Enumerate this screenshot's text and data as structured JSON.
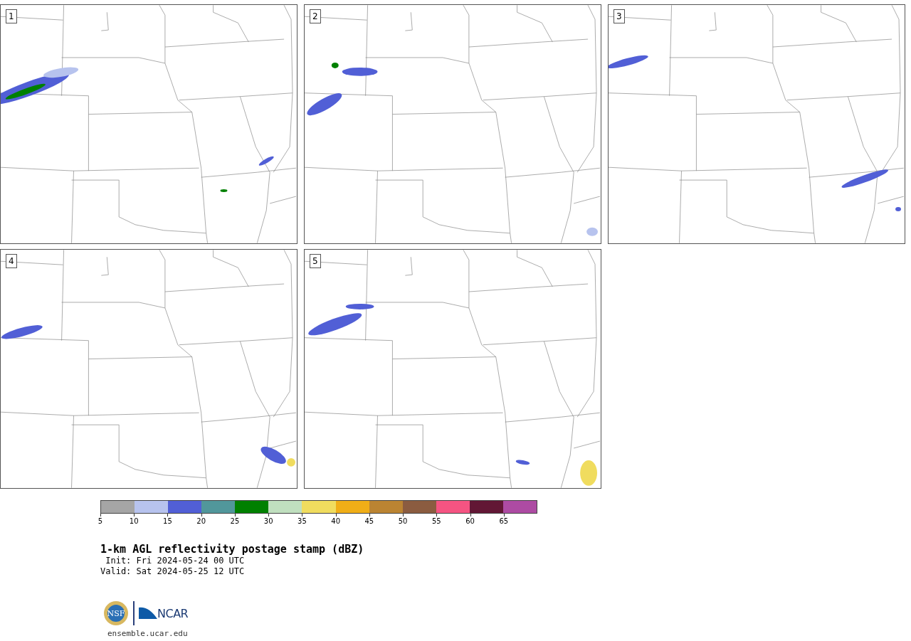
{
  "panels": [
    {
      "label": "1"
    },
    {
      "label": "2"
    },
    {
      "label": "3"
    },
    {
      "label": "4"
    },
    {
      "label": "5"
    }
  ],
  "colorbar": {
    "bins": [
      {
        "color": "#a5a5a5",
        "label": "5"
      },
      {
        "color": "#b7c3ee",
        "label": "10"
      },
      {
        "color": "#515fd6",
        "label": "15"
      },
      {
        "color": "#51979b",
        "label": "20"
      },
      {
        "color": "#008000",
        "label": "25"
      },
      {
        "color": "#c0dfbf",
        "label": "30"
      },
      {
        "color": "#f0dc5e",
        "label": "35"
      },
      {
        "color": "#f0ae17",
        "label": "40"
      },
      {
        "color": "#bb8432",
        "label": "45"
      },
      {
        "color": "#8b5c40",
        "label": "50"
      },
      {
        "color": "#f55482",
        "label": "55"
      },
      {
        "color": "#621735",
        "label": "60"
      },
      {
        "color": "#ad4ba3",
        "label": "65"
      }
    ]
  },
  "title": "1-km AGL reflectivity postage stamp (dBZ)",
  "init": " Init: Fri 2024-05-24 00 UTC",
  "valid": "Valid: Sat 2024-05-25 12 UTC",
  "logos": {
    "nsf": "NSF",
    "ncar": "NCAR"
  },
  "url": "ensemble.ucar.edu"
}
